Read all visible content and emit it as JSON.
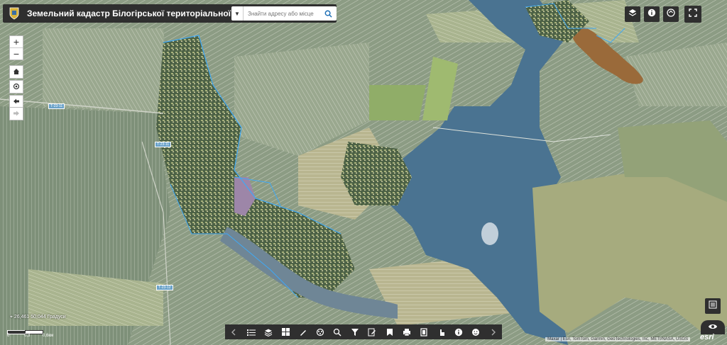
{
  "header": {
    "title": "Земельний кадастр Білогірської територіальної громади",
    "search_placeholder": "Знайти адресу або місце"
  },
  "map": {
    "road_labels": [
      "Т-23-11",
      "Т-23-11",
      "Т-23-12"
    ],
    "coordinates": "26,461 50,044 Градуси",
    "scale_labels": [
      "0",
      "0,3",
      "0,6км"
    ],
    "attribution": "Maxar | Esri, TomTom, Garmin, GeoTechnologies, Inc, METI/NASA, USGS",
    "esri_logo": "esri"
  },
  "controls": {
    "zoom_in": "+",
    "zoom_out": "−"
  },
  "icons": {
    "header": [
      "app-logo-icon",
      "chevron-down-icon",
      "search-icon"
    ],
    "map_tools": [
      "home-icon",
      "locate-icon",
      "back-icon",
      "forward-icon"
    ],
    "top_right": [
      "basemap-icon",
      "info-icon",
      "swipe-icon",
      "fullscreen-icon"
    ],
    "bottom_right": [
      "layer-list-icon",
      "eye-icon"
    ],
    "toolbar": [
      "chevron-left-icon",
      "legend-icon",
      "layers-icon",
      "basemap-gallery-icon",
      "draw-icon",
      "analysis-icon",
      "query-icon",
      "filter-icon",
      "edit-icon",
      "bookmark-icon",
      "print-icon",
      "select-icon",
      "identify-icon",
      "about-icon",
      "smile-icon",
      "chevron-right-icon"
    ]
  },
  "colors": {
    "panel": "#2f2f2f",
    "water": "#4a7391",
    "parcel_outline": "#3fa9f5",
    "accent": "#1e6fb5"
  }
}
